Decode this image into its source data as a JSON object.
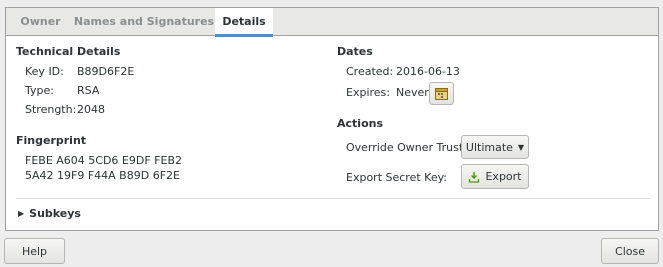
{
  "tabs": [
    "Owner",
    "Names and Signatures",
    "Details"
  ],
  "technical": {
    "heading": "Technical Details",
    "key_id_label": "Key ID:",
    "key_id": "B89D6F2E",
    "type_label": "Type:",
    "type": "RSA",
    "strength_label": "Strength:",
    "strength": "2048"
  },
  "fingerprint": {
    "heading": "Fingerprint",
    "line1": "FEBE A604 5CD6 E9DF FEB2",
    "line2": "5A42 19F9 F44A B89D 6F2E"
  },
  "dates": {
    "heading": "Dates",
    "created_label": "Created:",
    "created": "2016-06-13",
    "expires_label": "Expires:",
    "expires": "Never"
  },
  "actions": {
    "heading": "Actions",
    "trust_label": "Override Owner Trust:",
    "trust_value": "Ultimate",
    "export_label": "Export Secret Key:",
    "export_button": "Export"
  },
  "subkeys": "Subkeys",
  "footer": {
    "help": "Help",
    "close": "Close"
  },
  "colors": {
    "accent": "#4a90d9",
    "calendar_icon": "#c9a227",
    "export_icon": "#4e9a06"
  }
}
